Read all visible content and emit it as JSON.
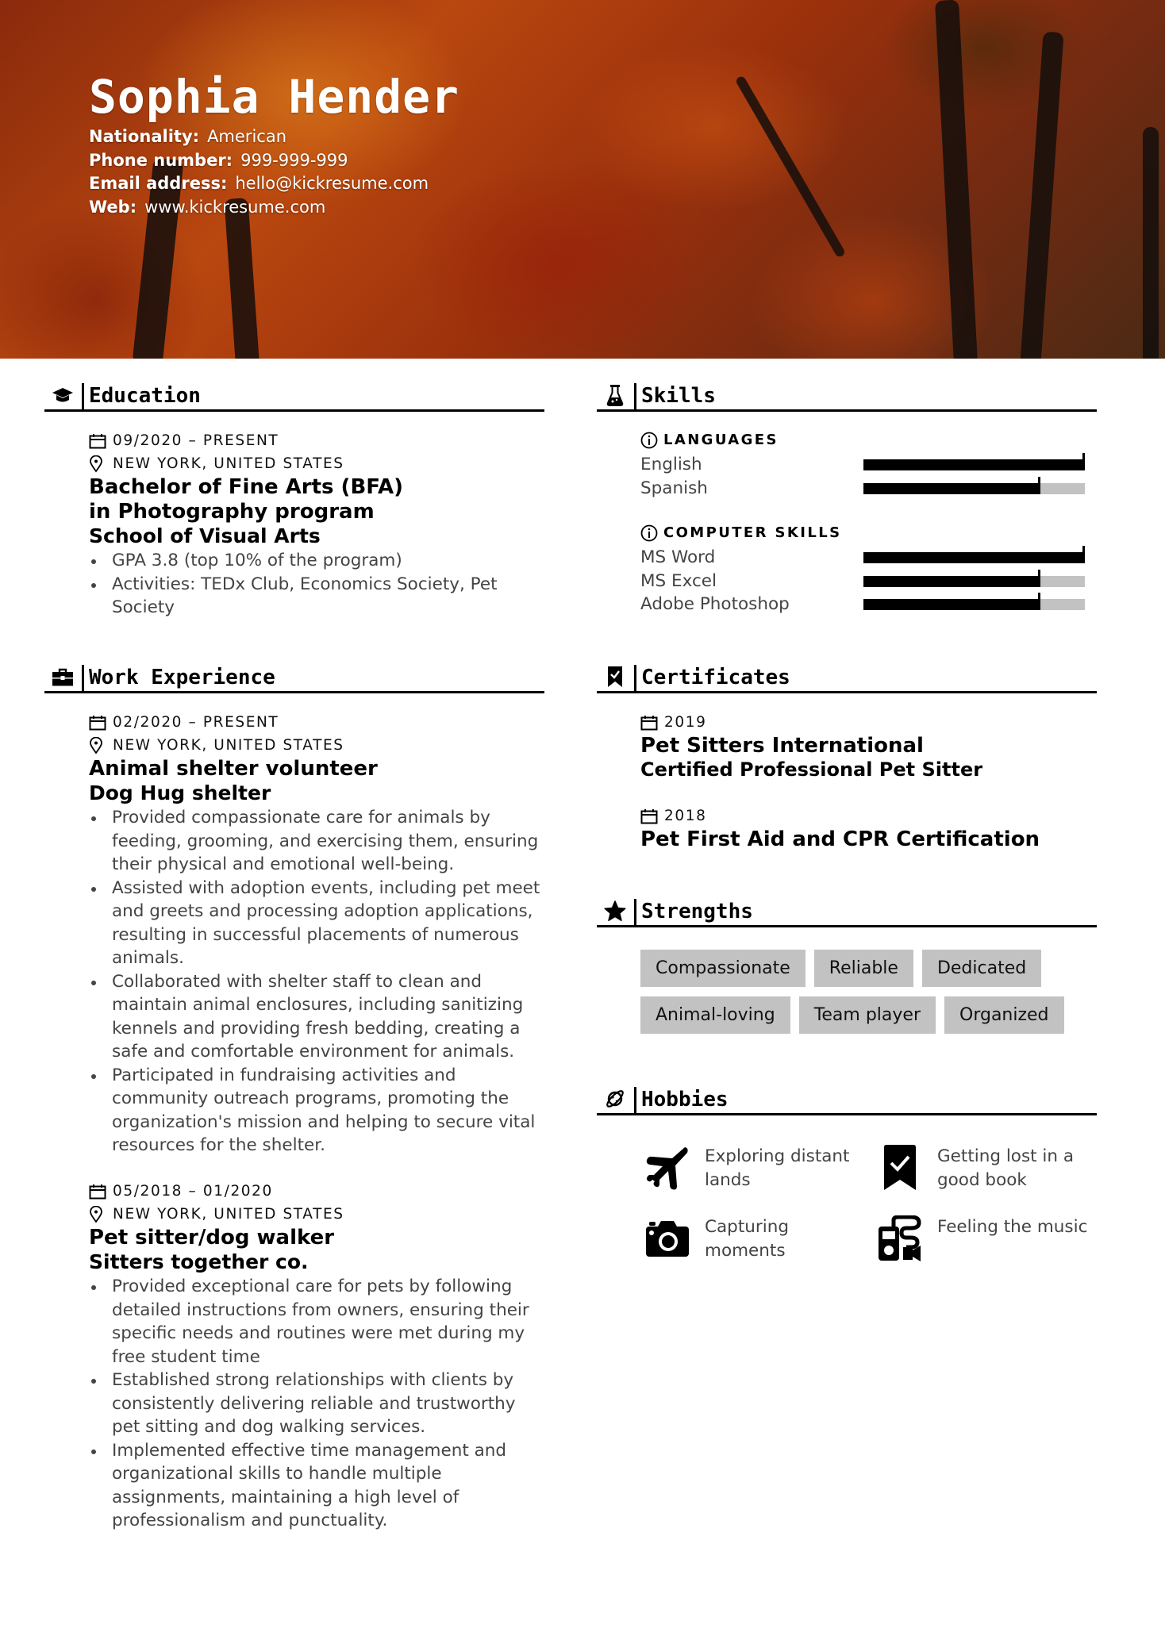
{
  "header": {
    "name": "Sophia Hender",
    "contacts": [
      {
        "label": "Nationality:",
        "value": "American"
      },
      {
        "label": "Phone number:",
        "value": "999-999-999"
      },
      {
        "label": "Email address:",
        "value": "hello@kickresume.com"
      },
      {
        "label": "Web:",
        "value": "www.kickresume.com"
      }
    ]
  },
  "education": {
    "title": "Education",
    "icon": "graduation-cap-icon",
    "entries": [
      {
        "date": "09/2020 – PRESENT",
        "location": "NEW YORK, UNITED STATES",
        "degree": "Bachelor of Fine Arts (BFA) in Photography program",
        "school": "School of Visual Arts",
        "bullets": [
          "GPA 3.8 (top 10% of the program)",
          "Activities: TEDx Club, Economics Society, Pet Society"
        ]
      }
    ]
  },
  "work": {
    "title": "Work Experience",
    "icon": "briefcase-icon",
    "entries": [
      {
        "date": "02/2020 – PRESENT",
        "location": "NEW YORK, UNITED STATES",
        "position": "Animal shelter volunteer",
        "company": "Dog Hug shelter",
        "bullets": [
          "Provided compassionate care for animals by feeding, grooming, and exercising them, ensuring their physical and emotional well-being.",
          "Assisted with adoption events, including pet meet and greets and processing adoption applications, resulting in successful placements of numerous animals.",
          "Collaborated with shelter staff to clean and maintain animal enclosures, including sanitizing kennels and providing fresh bedding, creating a safe and comfortable environment for animals.",
          "Participated in fundraising activities and community outreach programs, promoting the organization's mission and helping to secure vital resources for the shelter."
        ]
      },
      {
        "date": "05/2018 – 01/2020",
        "location": "NEW YORK, UNITED STATES",
        "position": "Pet sitter/dog walker",
        "company": "Sitters together co.",
        "bullets": [
          "Provided exceptional care for pets by following detailed instructions from owners, ensuring their specific needs and routines were met during my free student time",
          "Established strong relationships with clients by consistently delivering reliable and trustworthy pet sitting and dog walking services.",
          "Implemented effective time management and organizational skills to handle multiple assignments, maintaining a high level of professionalism and punctuality."
        ]
      }
    ]
  },
  "skills": {
    "title": "Skills",
    "icon": "flask-icon",
    "groups": [
      {
        "label": "LANGUAGES",
        "items": [
          {
            "name": "English",
            "level": 1.0
          },
          {
            "name": "Spanish",
            "level": 0.8
          }
        ]
      },
      {
        "label": "COMPUTER SKILLS",
        "items": [
          {
            "name": "MS Word",
            "level": 1.0
          },
          {
            "name": "MS Excel",
            "level": 0.8
          },
          {
            "name": "Adobe Photoshop",
            "level": 0.8
          }
        ]
      }
    ]
  },
  "certificates": {
    "title": "Certificates",
    "icon": "bookmark-check-icon",
    "entries": [
      {
        "date": "2019",
        "name": "Pet Sitters International",
        "detail": "Certified Professional Pet Sitter"
      },
      {
        "date": "2018",
        "name": "Pet First Aid and CPR Certification",
        "detail": ""
      }
    ]
  },
  "strengths": {
    "title": "Strengths",
    "icon": "star-icon",
    "items": [
      "Compassionate",
      "Reliable",
      "Dedicated",
      "Animal-loving",
      "Team player",
      "Organized"
    ]
  },
  "hobbies": {
    "title": "Hobbies",
    "icon": "planet-icon",
    "items": [
      {
        "icon": "airplane-icon",
        "label": "Exploring distant lands"
      },
      {
        "icon": "bookmark-check-icon",
        "label": "Getting lost in a good book"
      },
      {
        "icon": "camera-icon",
        "label": "Capturing moments"
      },
      {
        "icon": "music-player-icon",
        "label": "Feeling the music"
      }
    ]
  },
  "colors": {
    "text": "#000000",
    "body_text": "#444444",
    "tag_bg": "#c2c2c2",
    "skill_track": "#c2c2c2",
    "skill_fill": "#000000"
  }
}
